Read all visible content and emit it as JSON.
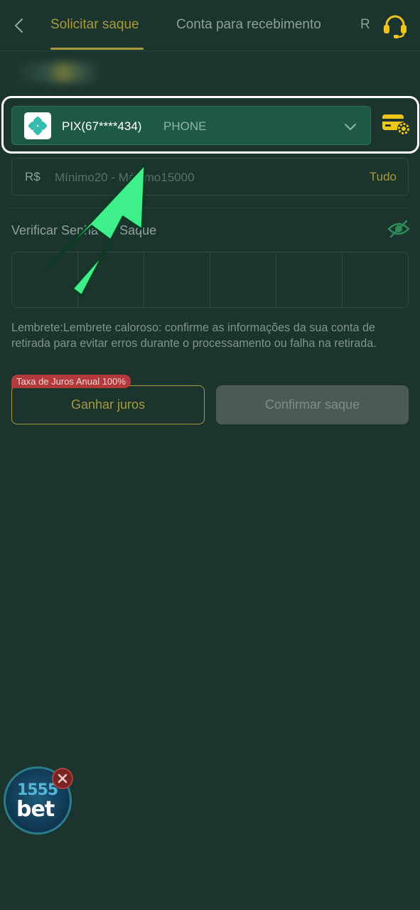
{
  "header": {
    "back_icon": "chevron-left-icon",
    "tabs": [
      {
        "label": "Solicitar saque",
        "active": true
      },
      {
        "label": "Conta para recebimento",
        "active": false
      },
      {
        "label": "R",
        "active": false
      }
    ],
    "support_icon": "headset-icon"
  },
  "withdraw_account": {
    "method_icon": "pix-icon",
    "label": "PIX(67****434)",
    "type": "PHONE",
    "dropdown_icon": "chevron-down-icon",
    "manage_icon": "card-settings-icon"
  },
  "amount": {
    "currency": "R$",
    "placeholder": "Mínimo20 - Máximo15000",
    "all_label": "Tudo"
  },
  "password": {
    "label": "Verificar Senha de Saque",
    "toggle_icon": "eye-off-icon",
    "digits": 6
  },
  "reminder": "Lembrete:Lembrete caloroso: confirme as informações da sua conta de retirada para evitar erros durante o processamento ou falha na retirada.",
  "actions": {
    "rate_badge": "Taxa de Juros Anual 100%",
    "earn_label": "Ganhar juros",
    "confirm_label": "Confirmar saque"
  },
  "promo": {
    "line1": "1555",
    "line2": "bet",
    "close_icon": "close-icon"
  },
  "colors": {
    "background": "#1b342e",
    "accent_gold": "#a89a3a",
    "pix_select_bg": "#1e5943",
    "arrow_green": "#3ef08a",
    "badge_red": "#b33a3a"
  }
}
